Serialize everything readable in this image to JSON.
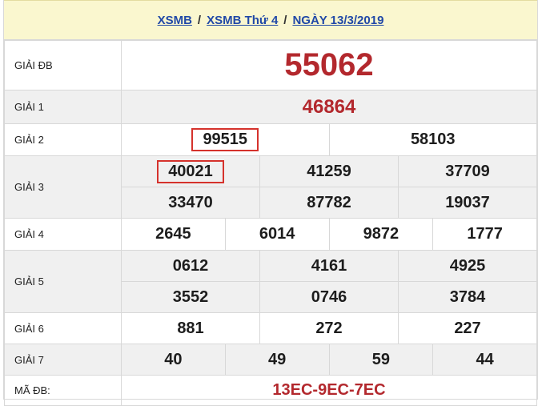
{
  "header": {
    "link1": "XSMB",
    "link2": "XSMB Thứ 4",
    "link3": "NGÀY 13/3/2019",
    "sep": "/"
  },
  "rows": {
    "db": {
      "label": "GIẢI ĐB",
      "values": [
        "55062"
      ]
    },
    "g1": {
      "label": "GIẢI 1",
      "values": [
        "46864"
      ]
    },
    "g2": {
      "label": "GIẢI 2",
      "values": [
        "99515",
        "58103"
      ]
    },
    "g3": {
      "label": "GIẢI 3",
      "values": [
        "40021",
        "41259",
        "37709",
        "33470",
        "87782",
        "19037"
      ]
    },
    "g4": {
      "label": "GIẢI 4",
      "values": [
        "2645",
        "6014",
        "9872",
        "1777"
      ]
    },
    "g5": {
      "label": "GIẢI 5",
      "values": [
        "0612",
        "4161",
        "4925",
        "3552",
        "0746",
        "3784"
      ]
    },
    "g6": {
      "label": "GIẢI 6",
      "values": [
        "881",
        "272",
        "227"
      ]
    },
    "g7": {
      "label": "GIẢI 7",
      "values": [
        "40",
        "49",
        "59",
        "44"
      ]
    },
    "madb": {
      "label": "MÃ ĐB:",
      "values": [
        "13EC-9EC-7EC"
      ]
    }
  },
  "colors": {
    "accent_red": "#b3282d",
    "header_bg": "#faf7cf",
    "link": "#2149a7",
    "highlight_box": "#d5322c"
  }
}
